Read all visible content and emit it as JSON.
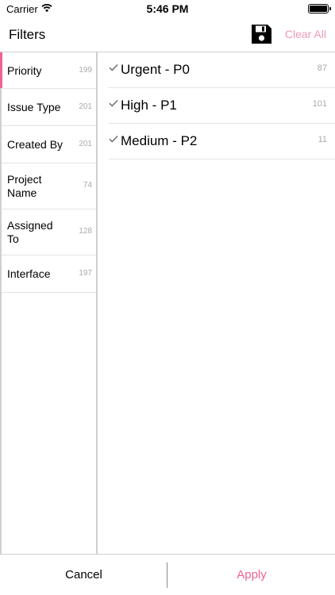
{
  "status_bar": {
    "carrier": "Carrier",
    "time": "5:46 PM"
  },
  "header": {
    "title": "Filters",
    "save_icon": "floppy-disk-icon",
    "clear_all_label": "Clear All",
    "accent_color": "#f06292"
  },
  "categories": [
    {
      "label": "Priority",
      "count": "199",
      "selected": true
    },
    {
      "label": "Issue Type",
      "count": "201"
    },
    {
      "label": "Created By",
      "count": "201"
    },
    {
      "label": "Project Name",
      "count": "74"
    },
    {
      "label": "Assigned To",
      "count": "128"
    },
    {
      "label": "Interface",
      "count": "197"
    }
  ],
  "options": [
    {
      "label": "Urgent - P0",
      "count": "87",
      "checked": true
    },
    {
      "label": "High - P1",
      "count": "101",
      "checked": true
    },
    {
      "label": "Medium - P2",
      "count": "11",
      "checked": true
    }
  ],
  "footer": {
    "cancel_label": "Cancel",
    "apply_label": "Apply"
  }
}
